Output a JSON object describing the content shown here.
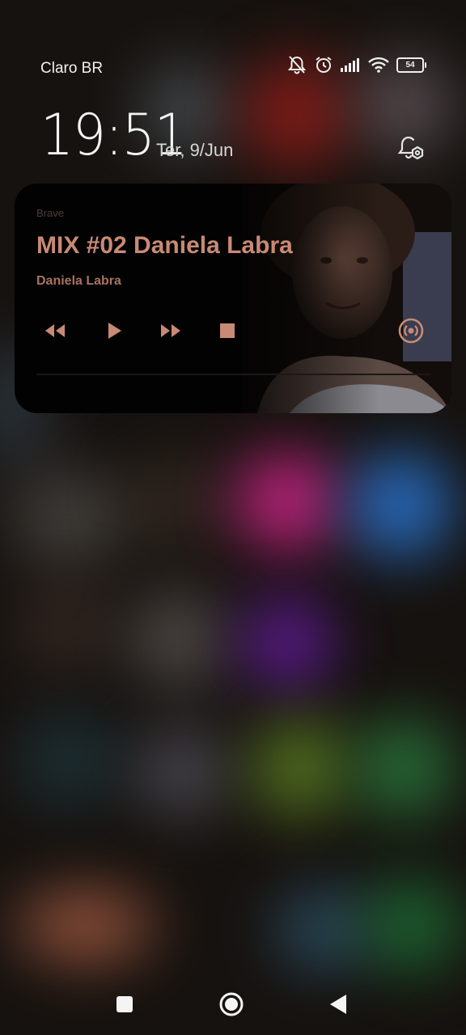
{
  "status_bar": {
    "carrier": "Claro BR",
    "icons": [
      "bell-muted-icon",
      "alarm-icon",
      "signal-icon",
      "wifi-icon",
      "battery-icon"
    ],
    "battery_level": "54"
  },
  "lock_screen": {
    "time": "19:51",
    "date": "Ter, 9/Jun",
    "settings_icon": "notification-settings-icon"
  },
  "media_player": {
    "app_name": "Brave",
    "title": "MIX #02 Daniela Labra",
    "artist": "Daniela Labra",
    "accent_color": "#c88a74",
    "controls": [
      "rewind-icon",
      "play-icon",
      "fast-forward-icon",
      "stop-icon",
      "cast-output-icon"
    ],
    "progress": 0
  },
  "navigation_bar": {
    "buttons": [
      "recents-icon",
      "home-icon",
      "back-icon"
    ]
  }
}
